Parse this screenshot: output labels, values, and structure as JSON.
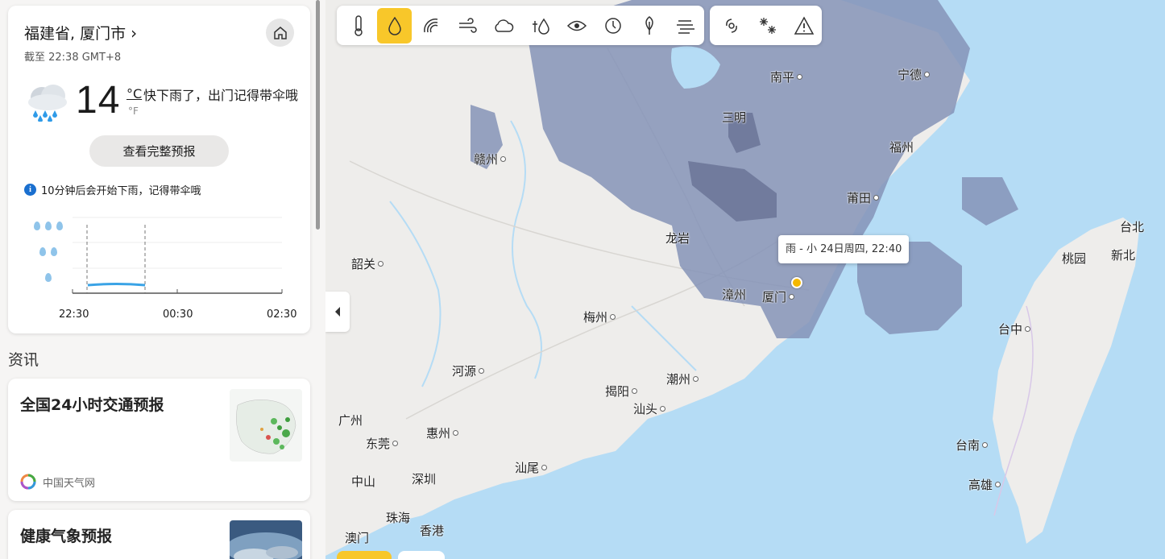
{
  "location": {
    "name": "福建省, 厦门市",
    "updated": "截至 22:38 GMT+8"
  },
  "current": {
    "temp": "14",
    "unit_c": "°C",
    "unit_f": "°F",
    "summary": "快下雨了，出门记得带伞哦",
    "icon": "rain-cloud-icon"
  },
  "buttons": {
    "full_forecast": "查看完整预报"
  },
  "alert": {
    "text": "10分钟后会开始下雨，记得带伞哦"
  },
  "precip_chart": {
    "times": [
      "22:30",
      "00:30",
      "02:30"
    ]
  },
  "news": {
    "header": "资讯",
    "items": [
      {
        "title": "全国24小时交通预报",
        "source": "中国天气网"
      },
      {
        "title": "健康气象预报",
        "source": ""
      }
    ]
  },
  "map": {
    "tooltip": "雨 - 小 24日周四, 22:40",
    "active_layer": "precipitation",
    "toolbar": [
      "thermometer-icon",
      "raindrop-icon",
      "pressure-icon",
      "wind-icon",
      "cloud-icon",
      "humidity-icon",
      "visibility-icon",
      "dewpoint-icon",
      "pollen-icon",
      "fog-icon",
      "hurricane-icon",
      "snowflake-icon",
      "warning-icon"
    ],
    "cities": [
      {
        "name": "南平"
      },
      {
        "name": "宁德"
      },
      {
        "name": "三明"
      },
      {
        "name": "福州"
      },
      {
        "name": "赣州"
      },
      {
        "name": "莆田"
      },
      {
        "name": "龙岩"
      },
      {
        "name": "韶关"
      },
      {
        "name": "漳州"
      },
      {
        "name": "厦门"
      },
      {
        "name": "梅州"
      },
      {
        "name": "河源"
      },
      {
        "name": "揭阳"
      },
      {
        "name": "潮州"
      },
      {
        "name": "汕头"
      },
      {
        "name": "广州"
      },
      {
        "name": "惠州"
      },
      {
        "name": "东莞"
      },
      {
        "name": "汕尾"
      },
      {
        "name": "中山"
      },
      {
        "name": "深圳"
      },
      {
        "name": "珠海"
      },
      {
        "name": "香港"
      },
      {
        "name": "澳门"
      },
      {
        "name": "台北"
      },
      {
        "name": "桃园"
      },
      {
        "name": "新北"
      },
      {
        "name": "台中"
      },
      {
        "name": "台南"
      },
      {
        "name": "高雄"
      }
    ]
  }
}
